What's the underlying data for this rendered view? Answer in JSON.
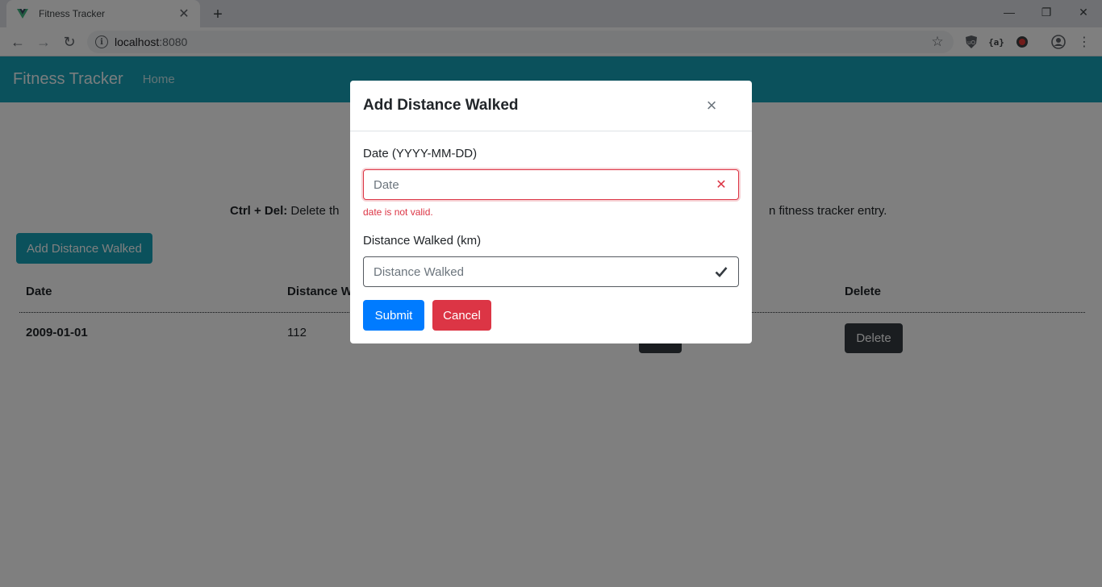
{
  "browser": {
    "tab_title": "Fitness Tracker",
    "url_host": "localhost",
    "url_port": ":8080"
  },
  "navbar": {
    "brand": "Fitness Tracker",
    "home": "Home"
  },
  "page": {
    "shortcut_key": "Ctrl + Del:",
    "shortcut_text": " Delete th",
    "shortcut_tail": "n fitness tracker entry.",
    "add_button": "Add Distance Walked",
    "table": {
      "headers": {
        "date": "Date",
        "distance": "Distance W",
        "delete": "Delete"
      },
      "rows": [
        {
          "date": "2009-01-01",
          "distance": "112",
          "delete_label": "Delete"
        }
      ]
    }
  },
  "modal": {
    "title": "Add Distance Walked",
    "close": "×",
    "date_label": "Date (YYYY-MM-DD)",
    "date_placeholder": "Date",
    "date_error": "date is not valid.",
    "distance_label": "Distance Walked (km)",
    "distance_placeholder": "Distance Walked",
    "submit": "Submit",
    "cancel": "Cancel"
  },
  "colors": {
    "primary": "#007bff",
    "danger": "#dc3545",
    "info": "#17a2b8",
    "dark": "#343a40"
  }
}
